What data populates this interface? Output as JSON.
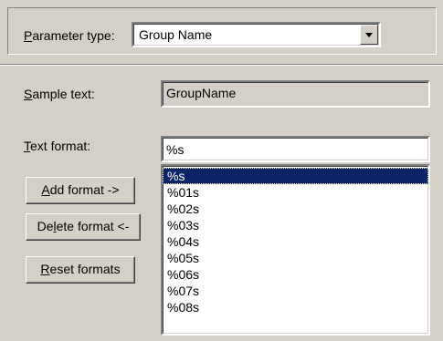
{
  "parameter_type": {
    "label_prefix": "",
    "label_mnemonic": "P",
    "label_rest": "arameter type:",
    "value": "Group Name",
    "dropdown_icon": "chevron-down-icon"
  },
  "sample_text": {
    "label_mnemonic": "S",
    "label_rest": "ample text:",
    "value": "GroupName"
  },
  "text_format": {
    "label_mnemonic": "T",
    "label_rest": "ext format:",
    "value": "%s",
    "options": [
      "%s",
      "%01s",
      "%02s",
      "%03s",
      "%04s",
      "%05s",
      "%06s",
      "%07s",
      "%08s"
    ],
    "selected_index": 0
  },
  "buttons": {
    "add": {
      "mnemonic": "A",
      "rest": "dd format ->"
    },
    "delete": {
      "pre": "De",
      "mnemonic": "l",
      "rest": "ete format <-"
    },
    "reset": {
      "mnemonic": "R",
      "rest": "eset formats"
    }
  },
  "colors": {
    "dialog_bg": "#d4d0c8",
    "selection_bg": "#0a246a",
    "field_bg": "#ffffff"
  }
}
